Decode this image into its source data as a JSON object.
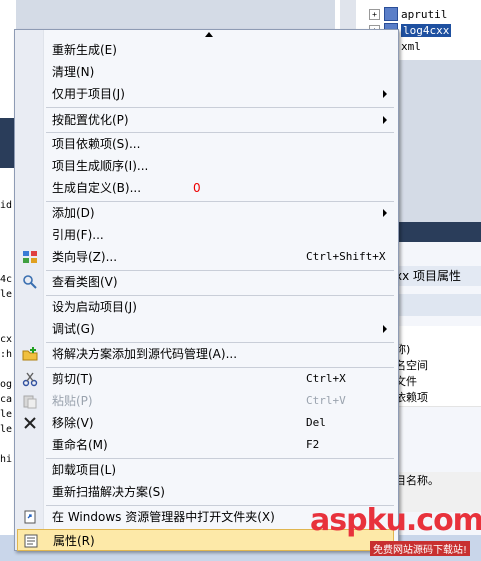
{
  "tree": {
    "items": [
      "aprutil",
      "log4cxx",
      "xml"
    ]
  },
  "background": {
    "left_fragments": [
      "id",
      "4c",
      "le",
      "cx",
      ":h",
      "og",
      "ca",
      "le",
      "le",
      "hi"
    ],
    "property_panel": {
      "title": "xx 项目属性",
      "rows": [
        ")",
        "称)",
        "名空间",
        "文件",
        "依赖项"
      ],
      "description": "目名称。"
    }
  },
  "menu": {
    "items": [
      {
        "label": "重新生成(E)"
      },
      {
        "label": "清理(N)"
      },
      {
        "label": "仅用于项目(J)"
      },
      {
        "label": "按配置优化(P)"
      },
      {
        "label": "项目依赖项(S)..."
      },
      {
        "label": "项目生成顺序(I)..."
      },
      {
        "label": "生成自定义(B)...",
        "annotation": "0"
      },
      {
        "label": "添加(D)"
      },
      {
        "label": "引用(F)..."
      },
      {
        "label": "类向导(Z)...",
        "shortcut": "Ctrl+Shift+X"
      },
      {
        "label": "查看类图(V)"
      },
      {
        "label": "设为启动项目(J)"
      },
      {
        "label": "调试(G)"
      },
      {
        "label": "将解决方案添加到源代码管理(A)..."
      },
      {
        "label": "剪切(T)",
        "shortcut": "Ctrl+X"
      },
      {
        "label": "粘贴(P)",
        "shortcut": "Ctrl+V"
      },
      {
        "label": "移除(V)",
        "shortcut": "Del"
      },
      {
        "label": "重命名(M)",
        "shortcut": "F2"
      },
      {
        "label": "卸载项目(L)"
      },
      {
        "label": "重新扫描解决方案(S)"
      },
      {
        "label": "在 Windows 资源管理器中打开文件夹(X)"
      },
      {
        "label": "属性(R)"
      }
    ]
  },
  "watermark": {
    "brand": "aspku",
    "tld": ".com",
    "tagline": "免费网站源码下载站!"
  }
}
